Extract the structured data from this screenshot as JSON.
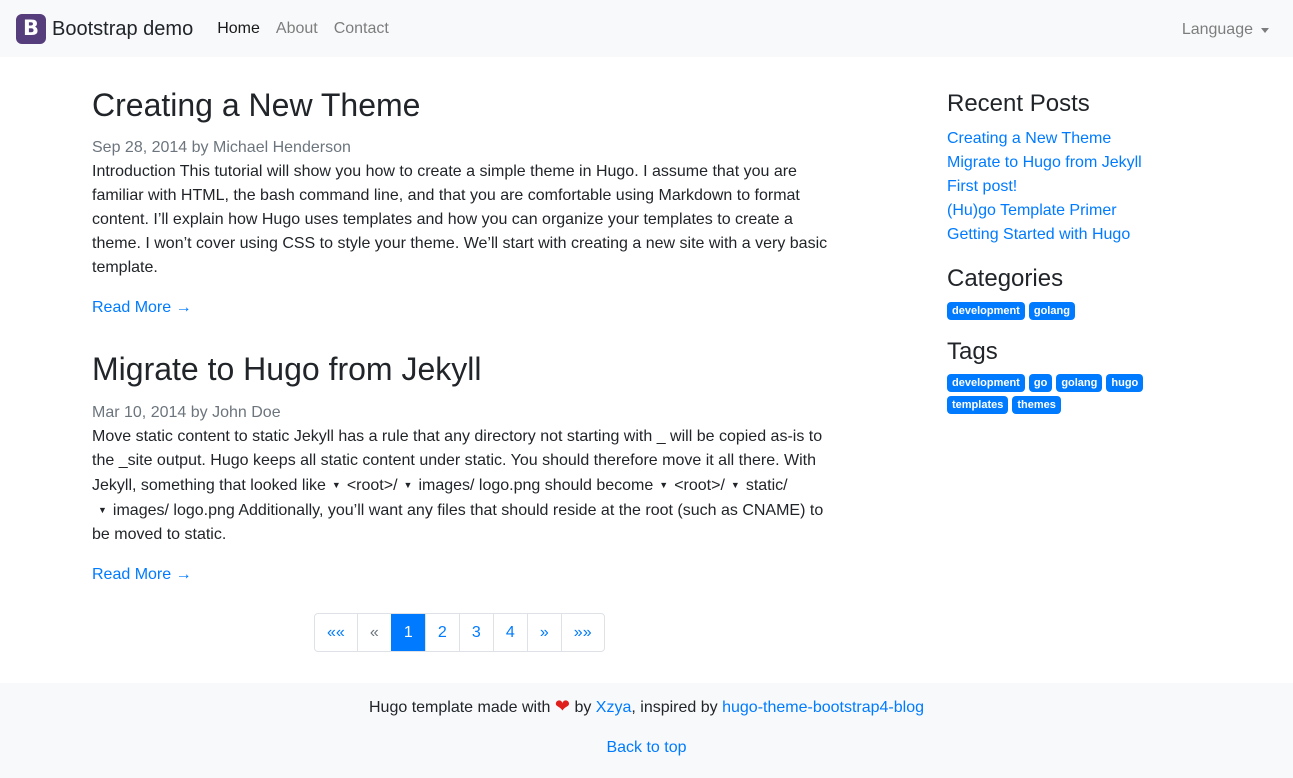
{
  "navbar": {
    "brand_letter": "B",
    "brand_name": "Bootstrap demo",
    "links": [
      {
        "label": "Home",
        "active": true
      },
      {
        "label": "About",
        "active": false
      },
      {
        "label": "Contact",
        "active": false
      }
    ],
    "language": "Language"
  },
  "posts": [
    {
      "title": "Creating a New Theme",
      "date": "Sep 28, 2014",
      "by": "by",
      "author": "Michael Henderson",
      "summary": "Introduction This tutorial will show you how to create a simple theme in Hugo. I assume that you are familiar with HTML, the bash command line, and that you are comfortable using Markdown to format content. I’ll explain how Hugo uses templates and how you can organize your templates to create a theme. I won’t cover using CSS to style your theme. We’ll start with creating a new site with a very basic template.",
      "read_more": "Read More →"
    },
    {
      "title": "Migrate to Hugo from Jekyll",
      "date": "Mar 10, 2014",
      "by": "by",
      "author": "John Doe",
      "summary_parts": [
        "Move static content to static Jekyll has a rule that any directory not starting with _ will be copied as-is to the _site output. Hugo keeps all static content under static. You should therefore move it all there. With Jekyll, something that looked like",
        "<root>/",
        "images/ logo.png should become",
        "<root>/",
        "static/",
        "images/ logo.png Additionally, you’ll want any files that should reside at the root (such as CNAME) to be moved to static."
      ],
      "read_more": "Read More →"
    }
  ],
  "pagination": {
    "first": "««",
    "prev": "«",
    "pages": [
      "1",
      "2",
      "3",
      "4"
    ],
    "active_page": "1",
    "next": "»",
    "last": "»»"
  },
  "sidebar": {
    "recent_title": "Recent Posts",
    "recent_posts": [
      "Creating a New Theme",
      "Migrate to Hugo from Jekyll",
      "First post!",
      "(Hu)go Template Primer",
      "Getting Started with Hugo"
    ],
    "categories_title": "Categories",
    "categories": [
      "development",
      "golang"
    ],
    "tags_title": "Tags",
    "tags": [
      "development",
      "go",
      "golang",
      "hugo",
      "templates",
      "themes"
    ]
  },
  "footer": {
    "made_with": "Hugo template made with",
    "heart": "❤",
    "by": "by",
    "author": "Xzya",
    "inspired": ", inspired by",
    "theme": "hugo-theme-bootstrap4-blog",
    "back_to_top": "Back to top"
  },
  "colors": {
    "brand": "#563d7c",
    "link": "#007bff",
    "navbar_bg": "#f8f9fa"
  }
}
